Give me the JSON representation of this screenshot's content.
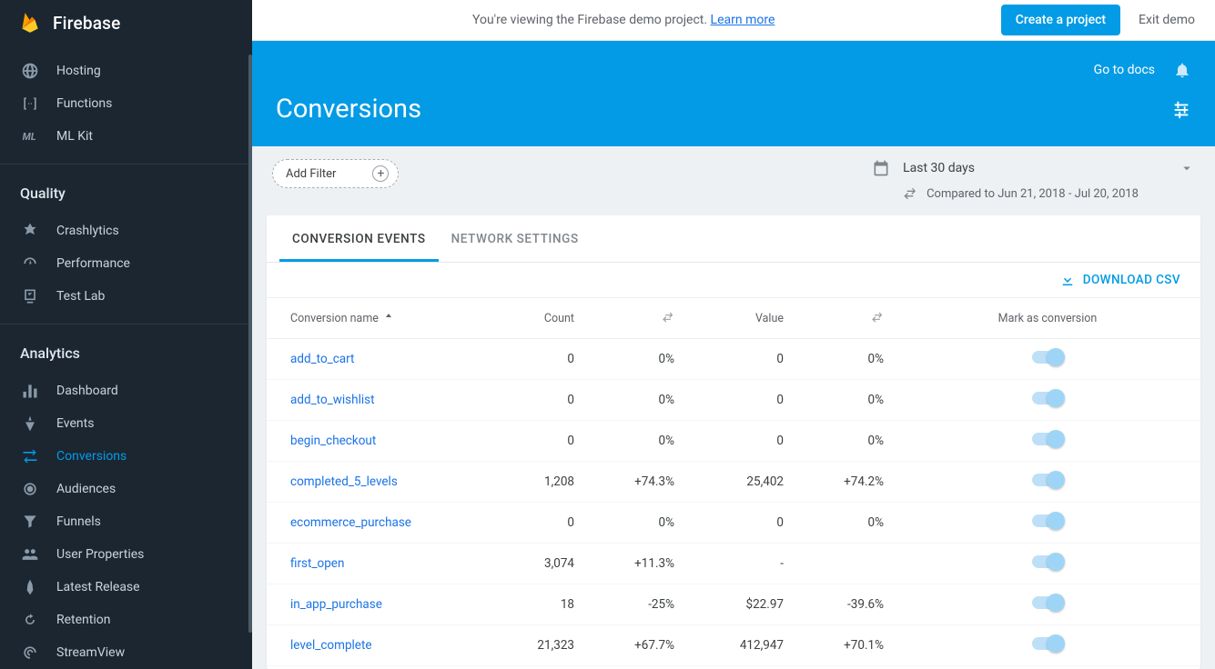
{
  "brand": "Firebase",
  "topbar": {
    "demo_text": "You're viewing the Firebase demo project. ",
    "learn_more": "Learn more",
    "create_project": "Create a project",
    "exit_demo": "Exit demo"
  },
  "sidebar": {
    "items_top": [
      {
        "label": "Hosting"
      },
      {
        "label": "Functions"
      },
      {
        "label": "ML Kit"
      }
    ],
    "quality_header": "Quality",
    "items_quality": [
      {
        "label": "Crashlytics"
      },
      {
        "label": "Performance"
      },
      {
        "label": "Test Lab"
      }
    ],
    "analytics_header": "Analytics",
    "items_analytics": [
      {
        "label": "Dashboard"
      },
      {
        "label": "Events"
      },
      {
        "label": "Conversions"
      },
      {
        "label": "Audiences"
      },
      {
        "label": "Funnels"
      },
      {
        "label": "User Properties"
      },
      {
        "label": "Latest Release"
      },
      {
        "label": "Retention"
      },
      {
        "label": "StreamView"
      }
    ]
  },
  "header": {
    "go_to_docs": "Go to docs",
    "title": "Conversions"
  },
  "controls": {
    "add_filter": "Add Filter",
    "date_range": "Last 30 days",
    "compared_to": "Compared to Jun 21, 2018 - Jul 20, 2018"
  },
  "tabs": {
    "conversion_events": "CONVERSION EVENTS",
    "network_settings": "NETWORK SETTINGS"
  },
  "download_csv": "DOWNLOAD CSV",
  "table": {
    "headers": {
      "name": "Conversion name",
      "count": "Count",
      "value": "Value",
      "mark": "Mark as conversion"
    },
    "rows": [
      {
        "name": "add_to_cart",
        "count": "0",
        "count_delta": "0%",
        "count_dir": "none",
        "value": "0",
        "value_delta": "0%",
        "value_dir": "none"
      },
      {
        "name": "add_to_wishlist",
        "count": "0",
        "count_delta": "0%",
        "count_dir": "none",
        "value": "0",
        "value_delta": "0%",
        "value_dir": "none"
      },
      {
        "name": "begin_checkout",
        "count": "0",
        "count_delta": "0%",
        "count_dir": "none",
        "value": "0",
        "value_delta": "0%",
        "value_dir": "none"
      },
      {
        "name": "completed_5_levels",
        "count": "1,208",
        "count_delta": "+74.3%",
        "count_dir": "pos",
        "value": "25,402",
        "value_delta": "+74.2%",
        "value_dir": "pos"
      },
      {
        "name": "ecommerce_purchase",
        "count": "0",
        "count_delta": "0%",
        "count_dir": "none",
        "value": "0",
        "value_delta": "0%",
        "value_dir": "none"
      },
      {
        "name": "first_open",
        "count": "3,074",
        "count_delta": "+11.3%",
        "count_dir": "pos",
        "value": "-",
        "value_delta": "",
        "value_dir": "none"
      },
      {
        "name": "in_app_purchase",
        "count": "18",
        "count_delta": "-25%",
        "count_dir": "neg",
        "value": "$22.97",
        "value_delta": "-39.6%",
        "value_dir": "neg"
      },
      {
        "name": "level_complete",
        "count": "21,323",
        "count_delta": "+67.7%",
        "count_dir": "pos",
        "value": "412,947",
        "value_delta": "+70.1%",
        "value_dir": "pos"
      }
    ]
  }
}
